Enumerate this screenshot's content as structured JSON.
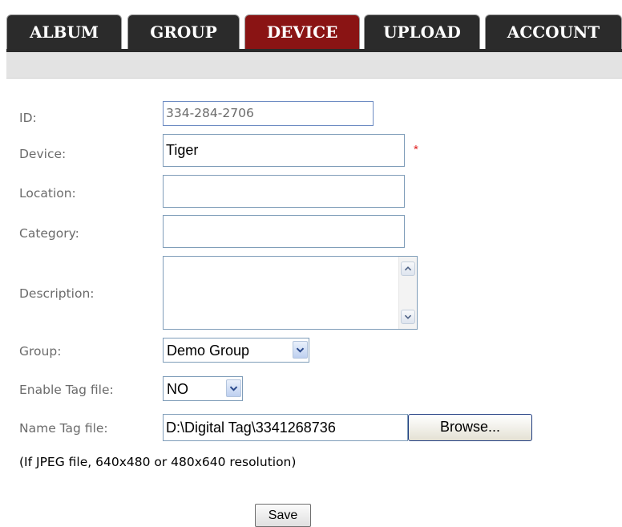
{
  "nav": {
    "tabs": [
      {
        "label": "ALBUM"
      },
      {
        "label": "GROUP"
      },
      {
        "label": "DEVICE"
      },
      {
        "label": "UPLOAD"
      },
      {
        "label": "ACCOUNT"
      }
    ],
    "active_tab": "DEVICE"
  },
  "form": {
    "id": {
      "label": "ID:",
      "value": "334-284-2706"
    },
    "device": {
      "label": "Device:",
      "value": "Tiger",
      "required_mark": "*"
    },
    "location": {
      "label": "Location:",
      "value": ""
    },
    "category": {
      "label": "Category:",
      "value": ""
    },
    "description": {
      "label": "Description:",
      "value": ""
    },
    "group": {
      "label": "Group:",
      "selected": "Demo Group"
    },
    "enable_tag": {
      "label": "Enable Tag file:",
      "selected": "NO"
    },
    "name_tag": {
      "label": "Name Tag file:",
      "value": "D:\\Digital Tag\\3341268736",
      "browse_label": "Browse..."
    },
    "note": "(If JPEG file, 640x480 or 480x640 resolution)",
    "save_label": "Save"
  },
  "colors": {
    "tab_bg": "#2b2b2b",
    "tab_active_bg": "#8a1414",
    "subbar_bg": "#e3e3e3",
    "label_text": "#6b6b6b",
    "input_border": "#7f9db9",
    "required": "#e02020"
  },
  "icons": {
    "scroll_up": "chevron-up-icon",
    "scroll_down": "chevron-down-icon",
    "dropdown": "chevron-down-icon"
  }
}
